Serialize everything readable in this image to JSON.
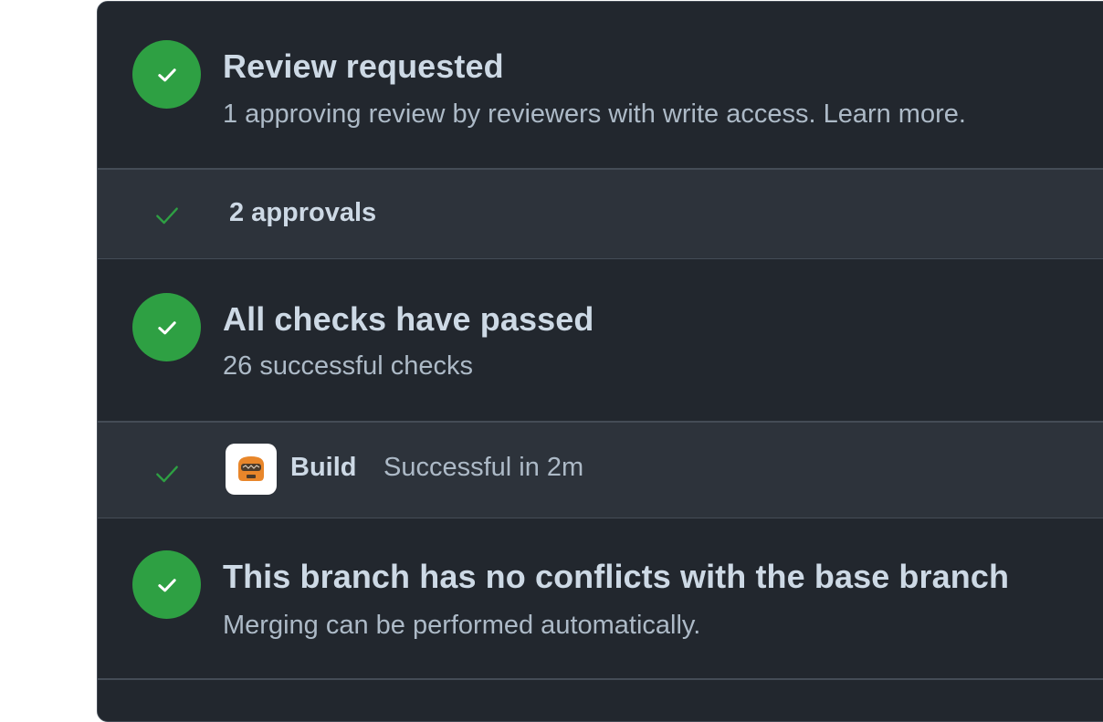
{
  "review": {
    "title": "Review requested",
    "subtitle": "1 approving review by reviewers with write access. Learn more.",
    "approvals_label": "2 approvals"
  },
  "checks": {
    "title": "All checks have passed",
    "subtitle": "26 successful checks",
    "build_name": "Build",
    "build_status": "Successful in 2m",
    "build_icon": "build-app-icon"
  },
  "merge": {
    "title": "This branch has no conflicts with the base branch",
    "subtitle": "Merging can be performed automatically."
  },
  "colors": {
    "success": "#2ea043",
    "panel_bg": "#22272e",
    "sub_bg": "#2d333b",
    "border": "#444c56",
    "text_primary": "#cdd9e5",
    "text_secondary": "#adbac7",
    "app_orange": "#e8862a"
  }
}
